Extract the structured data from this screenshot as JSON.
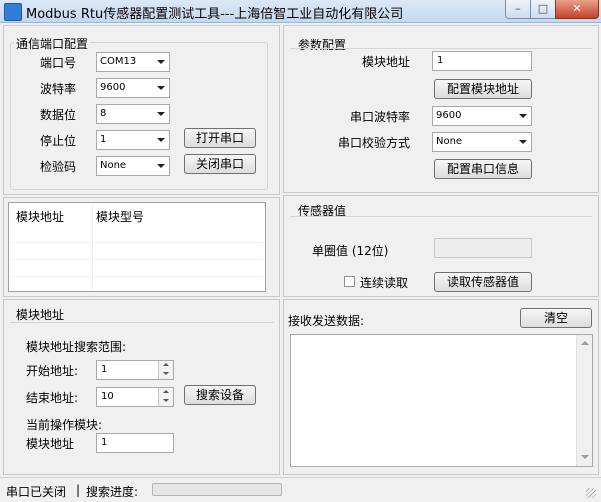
{
  "window": {
    "title": "Modbus Rtu传感器配置测试工具---上海倍智工业自动化有限公司",
    "min_glyph": "–",
    "max_glyph": "□",
    "close_glyph": "✕"
  },
  "serial_config": {
    "group_title": "通信端口配置",
    "port_label": "端口号",
    "port_value": "COM13",
    "baud_label": "波特率",
    "baud_value": "9600",
    "databits_label": "数据位",
    "databits_value": "8",
    "stopbits_label": "停止位",
    "stopbits_value": "1",
    "parity_label": "检验码",
    "parity_value": "None",
    "open_button": "打开串口",
    "close_button": "关闭串口"
  },
  "param_config": {
    "group_title": "参数配置",
    "module_addr_label": "模块地址",
    "module_addr_value": "1",
    "config_addr_button": "配置模块地址",
    "serial_baud_label": "串口波特率",
    "serial_baud_value": "9600",
    "serial_parity_label": "串口校验方式",
    "serial_parity_value": "None",
    "config_serial_button": "配置串口信息"
  },
  "module_list": {
    "columns": [
      "模块地址",
      "模块型号"
    ],
    "rows": []
  },
  "sensor": {
    "group_title": "传感器值",
    "single_turn_label": "单圈值 (12位)",
    "single_turn_value": "",
    "continuous_read_label": "连续读取",
    "continuous_read_checked": false,
    "read_button": "读取传感器值"
  },
  "module_addr_section": {
    "group_title": "模块地址",
    "search_range_label": "模块地址搜索范围:",
    "start_label": "开始地址:",
    "start_value": "1",
    "end_label": "结束地址:",
    "end_value": "10",
    "search_button": "搜索设备",
    "current_module_label": "当前操作模块:",
    "current_addr_label": "模块地址",
    "current_addr_value": "1"
  },
  "recv": {
    "label": "接收发送数据:",
    "clear_button": "清空",
    "content": ""
  },
  "status": {
    "port_status": "串口已关闭",
    "separator": "|",
    "search_progress_label": "搜索进度:",
    "search_progress": 0
  }
}
